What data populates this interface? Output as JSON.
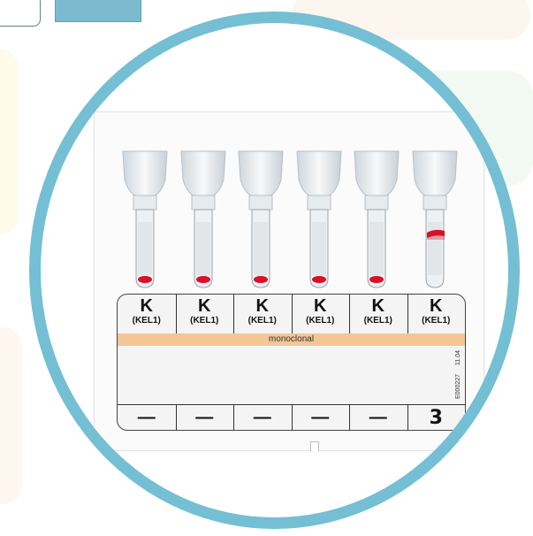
{
  "card": {
    "cells": [
      {
        "antigen": "K",
        "sub": "(KEL1)",
        "mark": "—"
      },
      {
        "antigen": "K",
        "sub": "(KEL1)",
        "mark": "—"
      },
      {
        "antigen": "K",
        "sub": "(KEL1)",
        "mark": "—"
      },
      {
        "antigen": "K",
        "sub": "(KEL1)",
        "mark": "—"
      },
      {
        "antigen": "K",
        "sub": "(KEL1)",
        "mark": "—"
      },
      {
        "antigen": "K",
        "sub": "(KEL1)",
        "mark": "3"
      }
    ],
    "type_label": "monoclonal",
    "lot": "11.04",
    "product_code": "E000227"
  },
  "colors": {
    "ring": "#74bfd3",
    "band": "#f3c696",
    "blood": "#d8102a"
  },
  "icons": [
    "gel-card-tube-icon"
  ]
}
